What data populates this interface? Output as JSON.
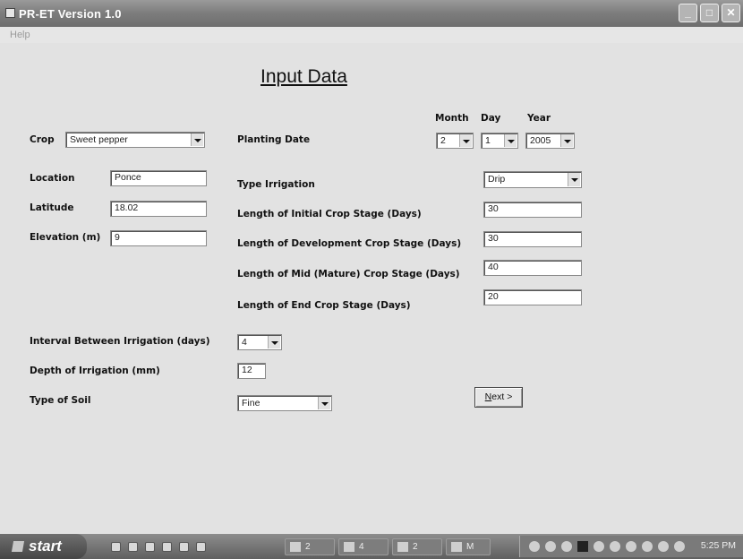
{
  "window": {
    "title": "PR-ET Version 1.0",
    "minimize_glyph": "_",
    "maximize_glyph": "□",
    "close_glyph": "✕"
  },
  "menu": {
    "help": "Help"
  },
  "form": {
    "heading": "Input Data",
    "crop": {
      "label": "Crop",
      "value": "Sweet pepper"
    },
    "location": {
      "label": "Location",
      "value": "Ponce"
    },
    "latitude": {
      "label": "Latitude",
      "value": "18.02"
    },
    "elevation": {
      "label": "Elevation (m)",
      "value": "9"
    },
    "planting_date": {
      "label": "Planting Date",
      "month_header": "Month",
      "day_header": "Day",
      "year_header": "Year",
      "month": "2",
      "day": "1",
      "year": "2005"
    },
    "type_irrigation": {
      "label": "Type Irrigation",
      "value": "Drip"
    },
    "initial_stage": {
      "label": "Length of Initial Crop Stage (Days)",
      "value": "30"
    },
    "development_stage": {
      "label": "Length of Development Crop Stage (Days)",
      "value": "30"
    },
    "mid_stage": {
      "label": "Length of Mid (Mature) Crop Stage (Days)",
      "value": "40"
    },
    "end_stage": {
      "label": "Length of End Crop Stage (Days)",
      "value": "20"
    },
    "interval": {
      "label": "Interval Between Irrigation (days)",
      "value": "4"
    },
    "depth": {
      "label": "Depth of Irrigation (mm)",
      "value": "12"
    },
    "soil": {
      "label": "Type of Soil",
      "value": "Fine"
    },
    "next_button": {
      "mnemonic": "N",
      "rest": "ext >"
    }
  },
  "taskbar": {
    "start_label": "start",
    "tasks": [
      "2",
      "4",
      "2",
      "M"
    ],
    "clock": "5:25 PM"
  }
}
